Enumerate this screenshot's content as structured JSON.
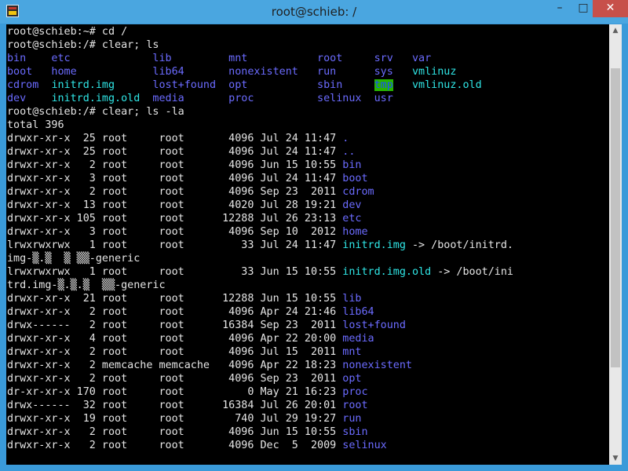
{
  "window": {
    "title": "root@schieb: /",
    "minimize_label": "–",
    "maximize_label": "□",
    "close_label": "✕",
    "icon": "putty-icon"
  },
  "colors": {
    "titlebar": "#4aa6e0",
    "terminal_bg": "#000000",
    "dir": "#6b6bff",
    "exec": "#2fe6e6",
    "highlight_bg": "#27b300"
  },
  "terminal": {
    "lines": [
      [
        {
          "t": "root@schieb:~# cd /"
        }
      ],
      [
        {
          "t": "root@schieb:/# clear; ls"
        }
      ],
      [
        {
          "t": "bin    etc             lib         mnt           root     srv   var",
          "c": "blue"
        }
      ],
      [
        {
          "t": "boot   home            lib64       nonexistent   run      sys   ",
          "c": "blue"
        },
        {
          "t": "vmlinuz",
          "c": "cyan"
        }
      ],
      [
        {
          "t": "cdrom  ",
          "c": "blue"
        },
        {
          "t": "initrd.img",
          "c": "cyan"
        },
        {
          "t": "      lost+found  opt           sbin     ",
          "c": "blue"
        },
        {
          "t": "tmp",
          "c": "hl"
        },
        {
          "t": "   "
        },
        {
          "t": "vmlinuz.old",
          "c": "cyan"
        }
      ],
      [
        {
          "t": "dev    ",
          "c": "blue"
        },
        {
          "t": "initrd.img.old",
          "c": "cyan"
        },
        {
          "t": "  media       proc          selinux  usr",
          "c": "blue"
        }
      ],
      [
        {
          "t": "root@schieb:/# clear; ls -la"
        }
      ],
      [
        {
          "t": "total 396"
        }
      ],
      [
        {
          "t": "drwxr-xr-x  25 root     root       4096 Jul 24 11:47 "
        },
        {
          "t": ".",
          "c": "blue"
        }
      ],
      [
        {
          "t": "drwxr-xr-x  25 root     root       4096 Jul 24 11:47 "
        },
        {
          "t": "..",
          "c": "blue"
        }
      ],
      [
        {
          "t": "drwxr-xr-x   2 root     root       4096 Jun 15 10:55 "
        },
        {
          "t": "bin",
          "c": "blue"
        }
      ],
      [
        {
          "t": "drwxr-xr-x   3 root     root       4096 Jul 24 11:47 "
        },
        {
          "t": "boot",
          "c": "blue"
        }
      ],
      [
        {
          "t": "drwxr-xr-x   2 root     root       4096 Sep 23  2011 "
        },
        {
          "t": "cdrom",
          "c": "blue"
        }
      ],
      [
        {
          "t": "drwxr-xr-x  13 root     root       4020 Jul 28 19:21 "
        },
        {
          "t": "dev",
          "c": "blue"
        }
      ],
      [
        {
          "t": "drwxr-xr-x 105 root     root      12288 Jul 26 23:13 "
        },
        {
          "t": "etc",
          "c": "blue"
        }
      ],
      [
        {
          "t": "drwxr-xr-x   3 root     root       4096 Sep 10  2012 "
        },
        {
          "t": "home",
          "c": "blue"
        }
      ],
      [
        {
          "t": "lrwxrwxrwx   1 root     root         33 Jul 24 11:47 "
        },
        {
          "t": "initrd.img",
          "c": "cyan"
        },
        {
          "t": " -> /boot/initrd."
        }
      ],
      [
        {
          "t": "img-▒.▒  ▒ ▒▒-generic"
        }
      ],
      [
        {
          "t": "lrwxrwxrwx   1 root     root         33 Jun 15 10:55 "
        },
        {
          "t": "initrd.img.old",
          "c": "cyan"
        },
        {
          "t": " -> /boot/ini"
        }
      ],
      [
        {
          "t": "trd.img-▒.▒.▒  ▒▒-generic"
        }
      ],
      [
        {
          "t": "drwxr-xr-x  21 root     root      12288 Jun 15 10:55 "
        },
        {
          "t": "lib",
          "c": "blue"
        }
      ],
      [
        {
          "t": "drwxr-xr-x   2 root     root       4096 Apr 24 21:46 "
        },
        {
          "t": "lib64",
          "c": "blue"
        }
      ],
      [
        {
          "t": "drwx------   2 root     root      16384 Sep 23  2011 "
        },
        {
          "t": "lost+found",
          "c": "blue"
        }
      ],
      [
        {
          "t": "drwxr-xr-x   4 root     root       4096 Apr 22 20:00 "
        },
        {
          "t": "media",
          "c": "blue"
        }
      ],
      [
        {
          "t": "drwxr-xr-x   2 root     root       4096 Jul 15  2011 "
        },
        {
          "t": "mnt",
          "c": "blue"
        }
      ],
      [
        {
          "t": "drwxr-xr-x   2 memcache memcache   4096 Apr 22 18:23 "
        },
        {
          "t": "nonexistent",
          "c": "blue"
        }
      ],
      [
        {
          "t": "drwxr-xr-x   2 root     root       4096 Sep 23  2011 "
        },
        {
          "t": "opt",
          "c": "blue"
        }
      ],
      [
        {
          "t": "dr-xr-xr-x 170 root     root          0 May 21 16:23 "
        },
        {
          "t": "proc",
          "c": "blue"
        }
      ],
      [
        {
          "t": "drwx------  32 root     root      16384 Jul 26 20:01 "
        },
        {
          "t": "root",
          "c": "blue"
        }
      ],
      [
        {
          "t": "drwxr-xr-x  19 root     root        740 Jul 29 19:27 "
        },
        {
          "t": "run",
          "c": "blue"
        }
      ],
      [
        {
          "t": "drwxr-xr-x   2 root     root       4096 Jun 15 10:55 "
        },
        {
          "t": "sbin",
          "c": "blue"
        }
      ],
      [
        {
          "t": "drwxr-xr-x   2 root     root       4096 Dec  5  2009 "
        },
        {
          "t": "selinux",
          "c": "blue"
        }
      ]
    ]
  },
  "scrollbar": {
    "up_icon": "▲",
    "down_icon": "▼",
    "position_fraction": 0.27,
    "visible_fraction": 0.72
  }
}
